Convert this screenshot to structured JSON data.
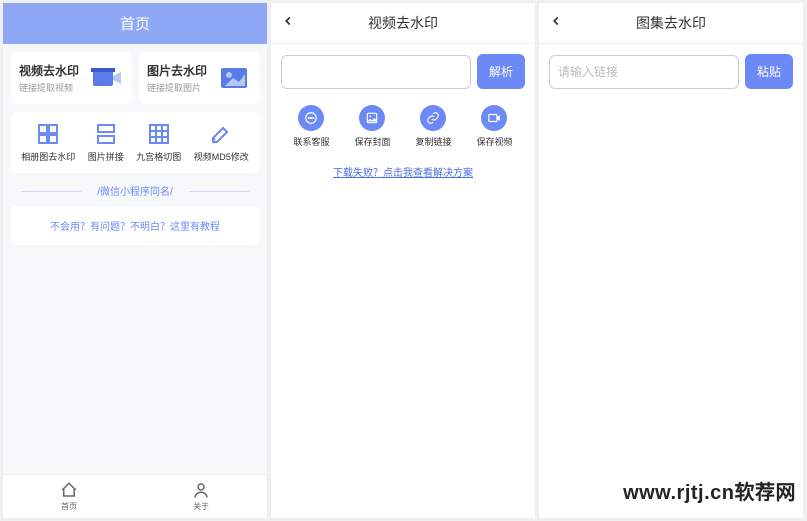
{
  "watermark": "www.rjtj.cn软荐网",
  "screen1": {
    "header": "首页",
    "cards": [
      {
        "title": "视频去水印",
        "sub": "链接提取视频"
      },
      {
        "title": "图片去水印",
        "sub": "链接提取图片"
      }
    ],
    "tools": [
      {
        "label": "相册图去水印"
      },
      {
        "label": "图片拼接"
      },
      {
        "label": "九宫格切图"
      },
      {
        "label": "视频MD5修改"
      }
    ],
    "divider": "/微信小程序同名/",
    "help": "不会用？有问题？不明白？这里有教程",
    "nav": [
      {
        "label": "首页"
      },
      {
        "label": "关于"
      }
    ]
  },
  "screen2": {
    "title": "视频去水印",
    "input_placeholder": "",
    "button": "解析",
    "actions": [
      {
        "label": "联系客服"
      },
      {
        "label": "保存封面"
      },
      {
        "label": "复制链接"
      },
      {
        "label": "保存视频"
      }
    ],
    "fail_link": "下载失败？点击我查看解决方案"
  },
  "screen3": {
    "title": "图集去水印",
    "input_placeholder": "请输入链接",
    "button": "粘贴"
  }
}
